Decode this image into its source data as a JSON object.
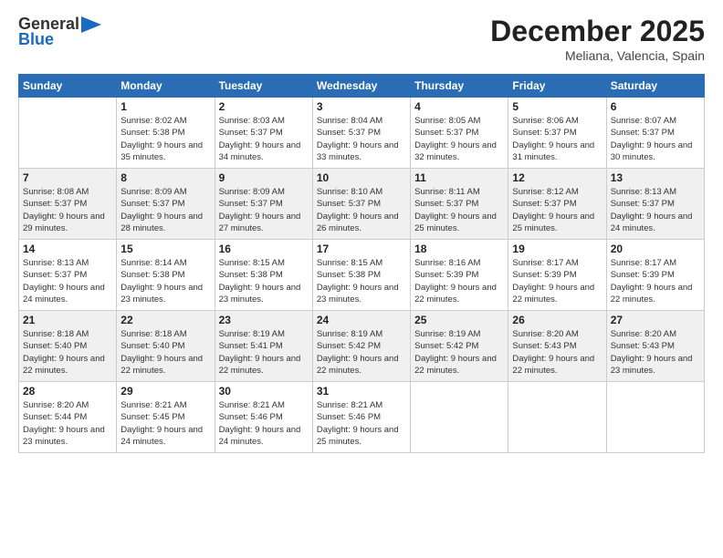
{
  "header": {
    "logo_general": "General",
    "logo_blue": "Blue",
    "month": "December 2025",
    "location": "Meliana, Valencia, Spain"
  },
  "weekdays": [
    "Sunday",
    "Monday",
    "Tuesday",
    "Wednesday",
    "Thursday",
    "Friday",
    "Saturday"
  ],
  "weeks": [
    [
      {
        "day": "",
        "sunrise": "",
        "sunset": "",
        "daylight": ""
      },
      {
        "day": "1",
        "sunrise": "Sunrise: 8:02 AM",
        "sunset": "Sunset: 5:38 PM",
        "daylight": "Daylight: 9 hours and 35 minutes."
      },
      {
        "day": "2",
        "sunrise": "Sunrise: 8:03 AM",
        "sunset": "Sunset: 5:37 PM",
        "daylight": "Daylight: 9 hours and 34 minutes."
      },
      {
        "day": "3",
        "sunrise": "Sunrise: 8:04 AM",
        "sunset": "Sunset: 5:37 PM",
        "daylight": "Daylight: 9 hours and 33 minutes."
      },
      {
        "day": "4",
        "sunrise": "Sunrise: 8:05 AM",
        "sunset": "Sunset: 5:37 PM",
        "daylight": "Daylight: 9 hours and 32 minutes."
      },
      {
        "day": "5",
        "sunrise": "Sunrise: 8:06 AM",
        "sunset": "Sunset: 5:37 PM",
        "daylight": "Daylight: 9 hours and 31 minutes."
      },
      {
        "day": "6",
        "sunrise": "Sunrise: 8:07 AM",
        "sunset": "Sunset: 5:37 PM",
        "daylight": "Daylight: 9 hours and 30 minutes."
      }
    ],
    [
      {
        "day": "7",
        "sunrise": "Sunrise: 8:08 AM",
        "sunset": "Sunset: 5:37 PM",
        "daylight": "Daylight: 9 hours and 29 minutes."
      },
      {
        "day": "8",
        "sunrise": "Sunrise: 8:09 AM",
        "sunset": "Sunset: 5:37 PM",
        "daylight": "Daylight: 9 hours and 28 minutes."
      },
      {
        "day": "9",
        "sunrise": "Sunrise: 8:09 AM",
        "sunset": "Sunset: 5:37 PM",
        "daylight": "Daylight: 9 hours and 27 minutes."
      },
      {
        "day": "10",
        "sunrise": "Sunrise: 8:10 AM",
        "sunset": "Sunset: 5:37 PM",
        "daylight": "Daylight: 9 hours and 26 minutes."
      },
      {
        "day": "11",
        "sunrise": "Sunrise: 8:11 AM",
        "sunset": "Sunset: 5:37 PM",
        "daylight": "Daylight: 9 hours and 25 minutes."
      },
      {
        "day": "12",
        "sunrise": "Sunrise: 8:12 AM",
        "sunset": "Sunset: 5:37 PM",
        "daylight": "Daylight: 9 hours and 25 minutes."
      },
      {
        "day": "13",
        "sunrise": "Sunrise: 8:13 AM",
        "sunset": "Sunset: 5:37 PM",
        "daylight": "Daylight: 9 hours and 24 minutes."
      }
    ],
    [
      {
        "day": "14",
        "sunrise": "Sunrise: 8:13 AM",
        "sunset": "Sunset: 5:37 PM",
        "daylight": "Daylight: 9 hours and 24 minutes."
      },
      {
        "day": "15",
        "sunrise": "Sunrise: 8:14 AM",
        "sunset": "Sunset: 5:38 PM",
        "daylight": "Daylight: 9 hours and 23 minutes."
      },
      {
        "day": "16",
        "sunrise": "Sunrise: 8:15 AM",
        "sunset": "Sunset: 5:38 PM",
        "daylight": "Daylight: 9 hours and 23 minutes."
      },
      {
        "day": "17",
        "sunrise": "Sunrise: 8:15 AM",
        "sunset": "Sunset: 5:38 PM",
        "daylight": "Daylight: 9 hours and 23 minutes."
      },
      {
        "day": "18",
        "sunrise": "Sunrise: 8:16 AM",
        "sunset": "Sunset: 5:39 PM",
        "daylight": "Daylight: 9 hours and 22 minutes."
      },
      {
        "day": "19",
        "sunrise": "Sunrise: 8:17 AM",
        "sunset": "Sunset: 5:39 PM",
        "daylight": "Daylight: 9 hours and 22 minutes."
      },
      {
        "day": "20",
        "sunrise": "Sunrise: 8:17 AM",
        "sunset": "Sunset: 5:39 PM",
        "daylight": "Daylight: 9 hours and 22 minutes."
      }
    ],
    [
      {
        "day": "21",
        "sunrise": "Sunrise: 8:18 AM",
        "sunset": "Sunset: 5:40 PM",
        "daylight": "Daylight: 9 hours and 22 minutes."
      },
      {
        "day": "22",
        "sunrise": "Sunrise: 8:18 AM",
        "sunset": "Sunset: 5:40 PM",
        "daylight": "Daylight: 9 hours and 22 minutes."
      },
      {
        "day": "23",
        "sunrise": "Sunrise: 8:19 AM",
        "sunset": "Sunset: 5:41 PM",
        "daylight": "Daylight: 9 hours and 22 minutes."
      },
      {
        "day": "24",
        "sunrise": "Sunrise: 8:19 AM",
        "sunset": "Sunset: 5:42 PM",
        "daylight": "Daylight: 9 hours and 22 minutes."
      },
      {
        "day": "25",
        "sunrise": "Sunrise: 8:19 AM",
        "sunset": "Sunset: 5:42 PM",
        "daylight": "Daylight: 9 hours and 22 minutes."
      },
      {
        "day": "26",
        "sunrise": "Sunrise: 8:20 AM",
        "sunset": "Sunset: 5:43 PM",
        "daylight": "Daylight: 9 hours and 22 minutes."
      },
      {
        "day": "27",
        "sunrise": "Sunrise: 8:20 AM",
        "sunset": "Sunset: 5:43 PM",
        "daylight": "Daylight: 9 hours and 23 minutes."
      }
    ],
    [
      {
        "day": "28",
        "sunrise": "Sunrise: 8:20 AM",
        "sunset": "Sunset: 5:44 PM",
        "daylight": "Daylight: 9 hours and 23 minutes."
      },
      {
        "day": "29",
        "sunrise": "Sunrise: 8:21 AM",
        "sunset": "Sunset: 5:45 PM",
        "daylight": "Daylight: 9 hours and 24 minutes."
      },
      {
        "day": "30",
        "sunrise": "Sunrise: 8:21 AM",
        "sunset": "Sunset: 5:46 PM",
        "daylight": "Daylight: 9 hours and 24 minutes."
      },
      {
        "day": "31",
        "sunrise": "Sunrise: 8:21 AM",
        "sunset": "Sunset: 5:46 PM",
        "daylight": "Daylight: 9 hours and 25 minutes."
      },
      {
        "day": "",
        "sunrise": "",
        "sunset": "",
        "daylight": ""
      },
      {
        "day": "",
        "sunrise": "",
        "sunset": "",
        "daylight": ""
      },
      {
        "day": "",
        "sunrise": "",
        "sunset": "",
        "daylight": ""
      }
    ]
  ]
}
